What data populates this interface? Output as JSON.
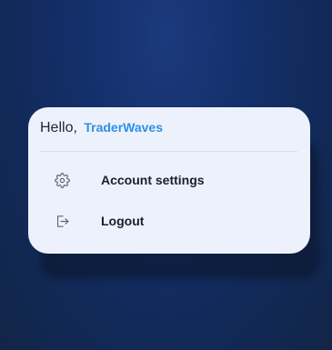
{
  "greeting": {
    "prefix": "Hello,",
    "username": "TraderWaves"
  },
  "menu": {
    "items": [
      {
        "label": "Account settings",
        "icon": "gear-icon"
      },
      {
        "label": "Logout",
        "icon": "logout-icon"
      }
    ]
  },
  "colors": {
    "accent": "#2f8fe6",
    "card_background": "#edf1fb",
    "page_background": "#14306b",
    "text": "#1a1f29",
    "icon": "#5d6472"
  }
}
